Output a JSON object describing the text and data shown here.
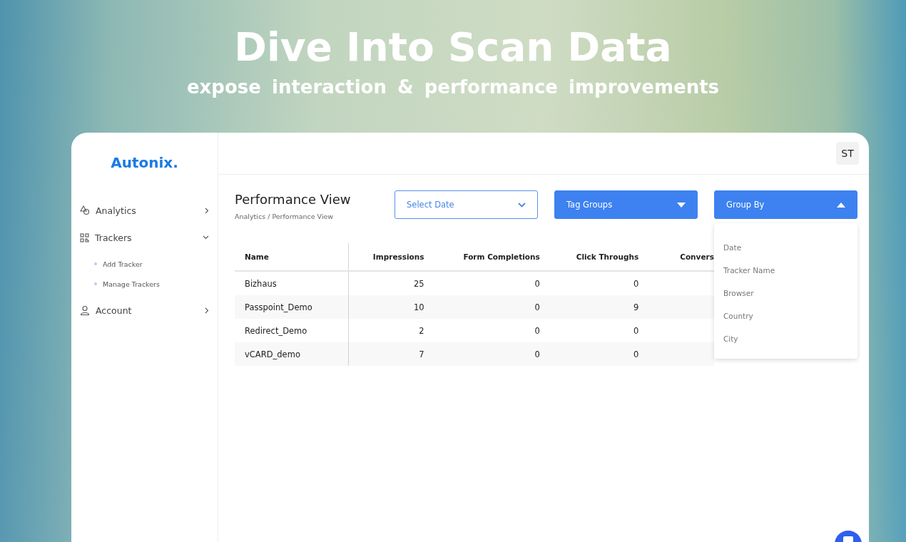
{
  "banner": {
    "title": "Dive Into Scan Data",
    "subtitle": "expose interaction & performance improvements"
  },
  "app": {
    "logo": "Autonix.",
    "avatar": "ST"
  },
  "sidebar": {
    "items": [
      {
        "label": "Analytics",
        "expanded": false
      },
      {
        "label": "Trackers",
        "expanded": true,
        "children": [
          {
            "label": "Add Tracker"
          },
          {
            "label": "Manage Trackers"
          }
        ]
      },
      {
        "label": "Account",
        "expanded": false
      }
    ]
  },
  "page": {
    "title": "Performance View",
    "breadcrumb": "Analytics / Performance View"
  },
  "filters": [
    {
      "label": "Select Date",
      "kind": "outline",
      "expanded": false
    },
    {
      "label": "Tag Groups",
      "kind": "filled",
      "expanded": false
    },
    {
      "label": "Group By",
      "kind": "filled",
      "expanded": true,
      "options": [
        "Date",
        "Tracker Name",
        "Browser",
        "Country",
        "City"
      ]
    }
  ],
  "table": {
    "columns": [
      "Name",
      "Impressions",
      "Form Completions",
      "Click Throughs",
      "Convers"
    ],
    "rows": [
      [
        "Bizhaus",
        "25",
        "0",
        "0"
      ],
      [
        "Passpoint_Demo",
        "10",
        "0",
        "9"
      ],
      [
        "Redirect_Demo",
        "2",
        "0",
        "0"
      ],
      [
        "vCARD_demo",
        "7",
        "0",
        "0"
      ]
    ]
  }
}
